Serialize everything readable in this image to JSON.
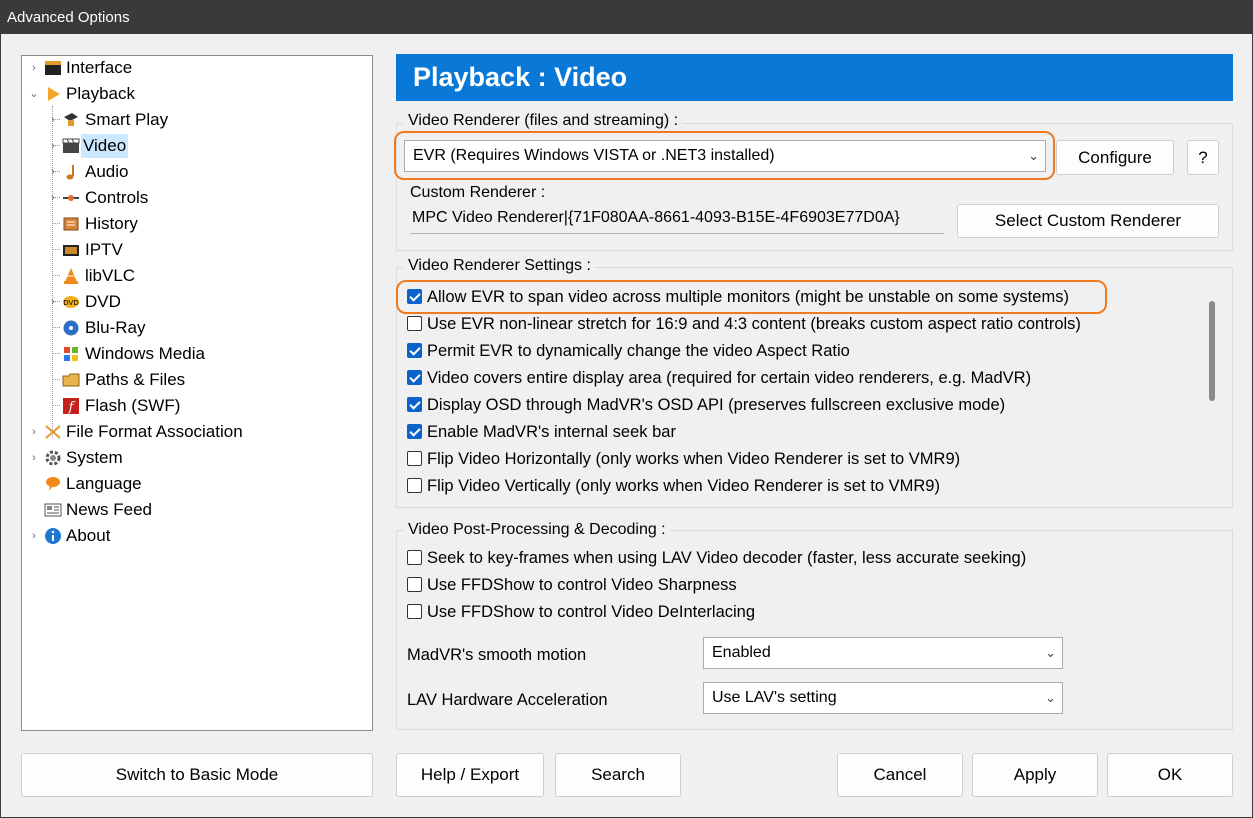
{
  "window": {
    "title": "Advanced Options"
  },
  "tree": {
    "items": [
      {
        "label": "Interface"
      },
      {
        "label": "Playback"
      },
      {
        "label": "Smart Play"
      },
      {
        "label": "Video"
      },
      {
        "label": "Audio"
      },
      {
        "label": "Controls"
      },
      {
        "label": "History"
      },
      {
        "label": "IPTV"
      },
      {
        "label": "libVLC"
      },
      {
        "label": "DVD"
      },
      {
        "label": "Blu-Ray"
      },
      {
        "label": "Windows Media"
      },
      {
        "label": "Paths & Files"
      },
      {
        "label": "Flash (SWF)"
      },
      {
        "label": "File Format Association"
      },
      {
        "label": "System"
      },
      {
        "label": "Language"
      },
      {
        "label": "News Feed"
      },
      {
        "label": "About"
      }
    ],
    "selected": "Video"
  },
  "panel": {
    "title": "Playback : Video",
    "renderer_group": {
      "title": "Video Renderer (files and streaming) :",
      "selected": "EVR (Requires Windows VISTA or .NET3 installed)",
      "configure_label": "Configure",
      "help_label": "?",
      "custom_label": "Custom Renderer :",
      "custom_value": "MPC Video Renderer|{71F080AA-8661-4093-B15E-4F6903E77D0A}",
      "select_custom_label": "Select Custom Renderer"
    },
    "settings_group": {
      "title": "Video Renderer Settings :",
      "options": [
        {
          "label": "Allow EVR to span video across multiple monitors (might be unstable on some systems)",
          "checked": "true"
        },
        {
          "label": "Use EVR non-linear stretch for 16:9 and 4:3 content (breaks custom aspect ratio controls)",
          "checked": "false"
        },
        {
          "label": "Permit EVR to dynamically change the video Aspect Ratio",
          "checked": "true"
        },
        {
          "label": "Video covers entire display area (required for certain video renderers, e.g. MadVR)",
          "checked": "true"
        },
        {
          "label": "Display OSD through MadVR's OSD API (preserves fullscreen exclusive mode)",
          "checked": "true"
        },
        {
          "label": "Enable MadVR's internal seek bar",
          "checked": "true"
        },
        {
          "label": "Flip Video Horizontally (only works when Video Renderer is set to VMR9)",
          "checked": "false"
        },
        {
          "label": "Flip Video Vertically (only works when Video Renderer is set to VMR9)",
          "checked": "false"
        }
      ]
    },
    "postproc_group": {
      "title": "Video Post-Processing & Decoding :",
      "options": [
        {
          "label": "Seek to key-frames when using LAV Video decoder (faster, less accurate seeking)",
          "checked": "false"
        },
        {
          "label": "Use FFDShow to control Video Sharpness",
          "checked": "false"
        },
        {
          "label": "Use FFDShow to control Video DeInterlacing",
          "checked": "false"
        }
      ],
      "smooth_motion_label": "MadVR's smooth motion",
      "smooth_motion_value": "Enabled",
      "hw_accel_label": "LAV Hardware Acceleration",
      "hw_accel_value": "Use LAV's setting"
    }
  },
  "footer": {
    "basic_mode": "Switch to Basic Mode",
    "help_export": "Help / Export",
    "search": "Search",
    "cancel": "Cancel",
    "apply": "Apply",
    "ok": "OK"
  },
  "colors": {
    "header_bg": "#0a78d7",
    "highlight": "#ee7b22",
    "checkbox_on": "#0a63c9",
    "selected_bg": "#cce8ff"
  }
}
